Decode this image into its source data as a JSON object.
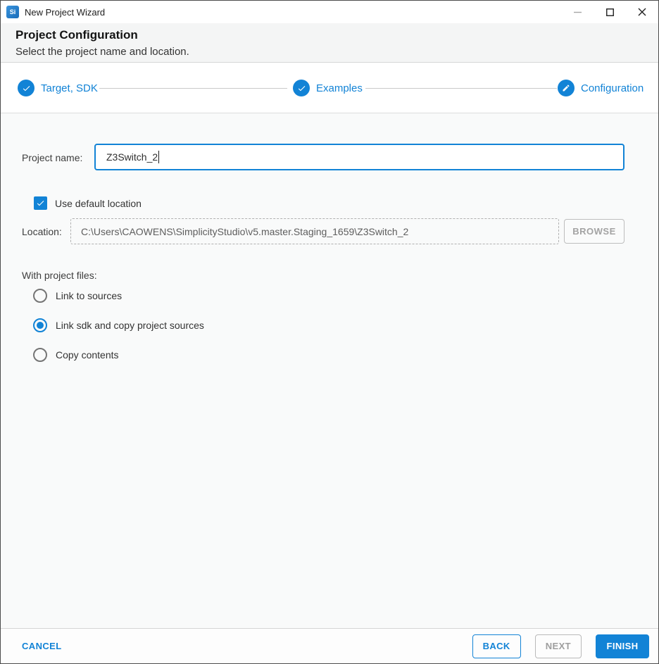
{
  "window": {
    "title": "New Project Wizard",
    "icon_text": "Si",
    "controls": {
      "minimize": "minimize",
      "maximize": "maximize",
      "close": "close"
    }
  },
  "header": {
    "title": "Project Configuration",
    "subtitle": "Select the project name and location."
  },
  "stepper": {
    "steps": [
      {
        "label": "Target, SDK",
        "state": "complete",
        "icon": "check"
      },
      {
        "label": "Examples",
        "state": "complete",
        "icon": "check"
      },
      {
        "label": "Configuration",
        "state": "current",
        "icon": "pencil"
      }
    ]
  },
  "form": {
    "project_name": {
      "label": "Project name:",
      "value": "Z3Switch_2"
    },
    "use_default_location": {
      "label": "Use default location",
      "checked": true
    },
    "location": {
      "label": "Location:",
      "value": "C:\\Users\\CAOWENS\\SimplicityStudio\\v5.master.Staging_1659\\Z3Switch_2",
      "browse_label": "BROWSE",
      "enabled": false
    },
    "with_project_files": {
      "label": "With project files:",
      "options": [
        {
          "label": "Link to sources",
          "selected": false
        },
        {
          "label": "Link sdk and copy project sources",
          "selected": true
        },
        {
          "label": "Copy contents",
          "selected": false
        }
      ]
    }
  },
  "footer": {
    "cancel_label": "CANCEL",
    "back_label": "BACK",
    "next_label": "NEXT",
    "finish_label": "FINISH"
  },
  "colors": {
    "accent": "#1283d6",
    "header_bg": "#f4f5f5",
    "body_bg": "#f9fafa",
    "disabled_text": "#9e9e9e",
    "divider": "#d8d8d8"
  }
}
